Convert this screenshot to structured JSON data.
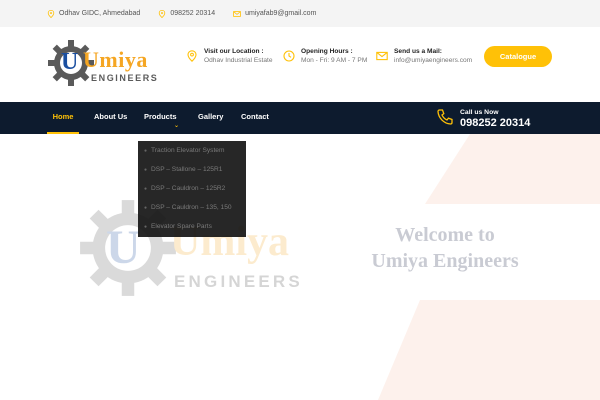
{
  "topbar": {
    "address": "Odhav GIDC, Ahmedabad",
    "phone": "098252 20314",
    "email": "umiyafab9@gmail.com"
  },
  "logo": {
    "letter": "U",
    "brand": "Umiya",
    "subtitle": "ENGINEERS"
  },
  "header": {
    "location_title": "Visit our Location :",
    "location_value": "Odhav Industrial Estate",
    "hours_title": "Opening Hours :",
    "hours_value": "Mon - Fri: 9 AM - 7 PM",
    "mail_title": "Send us a Mail:",
    "mail_value": "info@umiyaengineers.com",
    "catalogue_label": "Catalogue"
  },
  "nav": {
    "items": [
      {
        "label": "Home",
        "active": true
      },
      {
        "label": "About Us"
      },
      {
        "label": "Products"
      },
      {
        "label": "Gallery"
      },
      {
        "label": "Contact"
      }
    ],
    "call_label": "Call us Now",
    "call_number": "098252 20314"
  },
  "dropdown": {
    "items": [
      "Traction Elevator System",
      "DSP – Stallone – 125R1",
      "DSP – Cauldron – 125R2",
      "DSP – Cauldron – 135, 150",
      "Elevator Spare Parts"
    ]
  },
  "hero": {
    "welcome_line1": "Welcome to",
    "welcome_line2": "Umiya Engineers"
  },
  "colors": {
    "accent": "#ffc107",
    "nav_bg": "#0d1b2e",
    "brand_blue": "#1b4fa0",
    "brand_orange": "#f5a623"
  }
}
